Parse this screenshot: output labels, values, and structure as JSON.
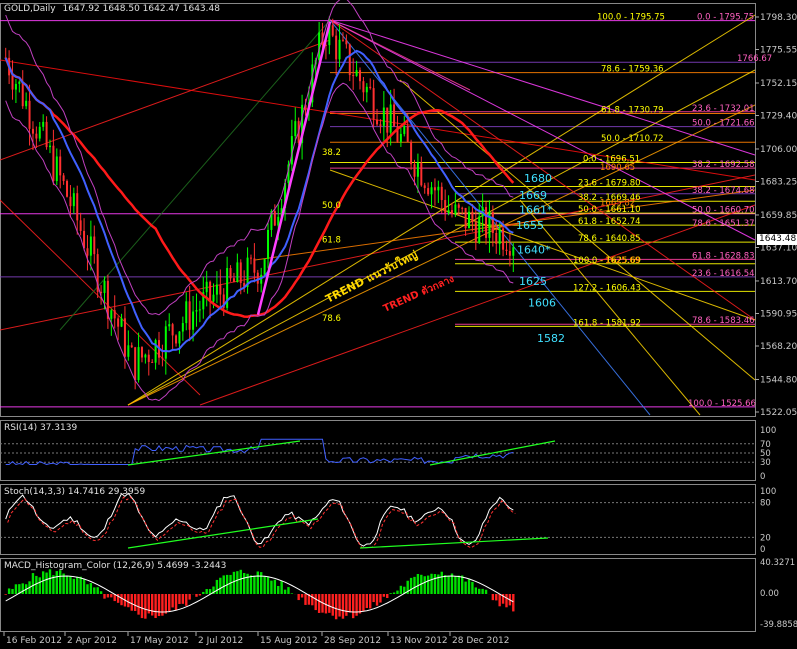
{
  "chart_title": "GOLD,Daily",
  "ohlc_readout": "1647.92 1648.50 1642.47 1643.48",
  "price_axis": [
    "1798.30",
    "1775.55",
    "1752.15",
    "1729.40",
    "1706.00",
    "1683.25",
    "1659.85",
    "1637.10",
    "1613.70",
    "1590.95",
    "1568.20",
    "1544.80",
    "1522.05"
  ],
  "current_price": "1643.48",
  "date_axis": [
    "16 Feb 2012",
    "2 Apr 2012",
    "17 May 2012",
    "2 Jul 2012",
    "15 Aug 2012",
    "28 Sep 2012",
    "13 Nov 2012",
    "28 Dec 2012"
  ],
  "fib_labels": {
    "set_a": [
      "100.0 - 1795.75",
      "78.6 - 1759.36",
      "61.8 - 1730.79",
      "50.0 - 1710.72",
      "38.2",
      "0.0 - 1696.51",
      "23.6 - 1679.80",
      "38.2 - 1669.46",
      "50.0 - 1661.10",
      "61.8 - 1652.74",
      "78.6 - 1640.85",
      "100.0 - 1625.69",
      "127.2 - 1606.43",
      "161.8 - 1581.92",
      "50.0",
      "61.8",
      "78.6"
    ],
    "set_b": [
      "0.0 - 1795.75",
      "1766.67",
      "23.6 - 1732.01",
      "50.0 - 1721.66",
      "38.2 - 1692.58",
      "38.2 - 1674.68",
      "50.0 - 1660.70",
      "78.6 - 1651.37",
      "61.8 - 1628.83",
      "23.6 - 1616.54",
      "78.6 - 1583.46",
      "100.0 - 1525.66",
      "1690.65",
      "1665.82",
      "1625.69"
    ]
  },
  "level_labels": [
    "1680",
    "1669",
    "1661*",
    "1655",
    "1640*",
    "1625",
    "1606",
    "1582"
  ],
  "trend_labels": [
    "TREND แนวรับใหญ่",
    "TREND ตัวกลาง"
  ],
  "colors": {
    "background": "#000000",
    "candle_up": "#00ff00",
    "candle_down": "#ff3030",
    "ma_slow": "#ff1a1a",
    "ma_fast": "#4060ff",
    "level_text": "#40e0ff",
    "trend_main": "#ffd800",
    "trend_mid": "#ff2020",
    "support_line": "#20ff20"
  },
  "rsi": {
    "label": "RSI(14) 37.3139",
    "axis": [
      "100",
      "70",
      "50",
      "30",
      "0"
    ]
  },
  "stoch": {
    "label": "Stoch(14,3,3) 14.7416 29.3959",
    "axis": [
      "100",
      "80",
      "20",
      "0"
    ]
  },
  "macd": {
    "label": "MACD_Histogram_Color (12,26,9)  5.4699 -3.2443",
    "axis": [
      "40.3271",
      "0.00",
      "-39.8858"
    ]
  },
  "chart_data": {
    "type": "candlestick",
    "title": "GOLD,Daily",
    "x": [
      "16 Feb 2012",
      "2 Apr 2012",
      "17 May 2012",
      "2 Jul 2012",
      "15 Aug 2012",
      "28 Sep 2012",
      "13 Nov 2012",
      "28 Dec 2012"
    ],
    "close": [
      1770,
      1670,
      1555,
      1595,
      1625,
      1790,
      1725,
      1660
    ],
    "last": {
      "open": 1647.92,
      "high": 1648.5,
      "low": 1642.47,
      "close": 1643.48
    },
    "ylim": [
      1515,
      1810
    ]
  }
}
